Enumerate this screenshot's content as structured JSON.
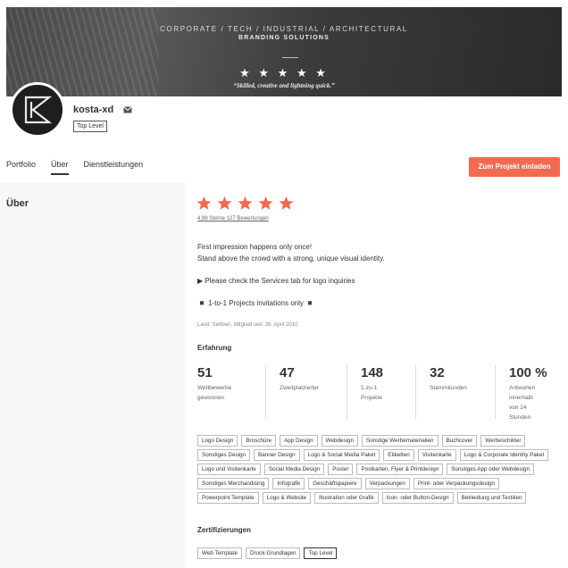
{
  "banner": {
    "line1": "CORPORATE / TECH / INDUSTRIAL / ARCHITECTURAL",
    "line2": "BRANDING SOLUTIONS",
    "stars": "★ ★ ★ ★ ★",
    "quote": "“Skilled, creative and lightning quick.”"
  },
  "profile": {
    "username": "kosta-xd",
    "level": "Top Level"
  },
  "tabs": [
    {
      "label": "Portfolio"
    },
    {
      "label": "Über"
    },
    {
      "label": "Dienstleistungen"
    }
  ],
  "invite_label": "Zum Projekt einladen",
  "section_title": "Über",
  "rating": {
    "stars": 5,
    "text": "4,98 Sterne 127 Bewertungen"
  },
  "bio": {
    "line1": "First impression happens only once!",
    "line2": "Stand above the crowd with a strong, unique visual identity.",
    "line3": "▶ Please check the Services tab for logo inquiries",
    "line4": "◾ 1-to-1 Projects invitations only ◾"
  },
  "meta": "Land: Serbien, Mitglied seit: 26. April 2010",
  "experience_title": "Erfahrung",
  "stats": [
    {
      "value": "51",
      "label": [
        "Wettbewerbe",
        "gewonnen"
      ]
    },
    {
      "value": "47",
      "label": [
        "Zweitplatzierter"
      ]
    },
    {
      "value": "148",
      "label": [
        "1-zu-1",
        "Projekte"
      ]
    },
    {
      "value": "32",
      "label": [
        "Stammkunden"
      ]
    },
    {
      "value": "100 %",
      "label": [
        "Antworten",
        "innerhalb",
        "von 24",
        "Stunden"
      ]
    }
  ],
  "tags": [
    "Logo Design",
    "Broschüre",
    "App Design",
    "Webdesign",
    "Sonstige Werbematerialien",
    "Buchcover",
    "Werbeschilder",
    "Sonstiges Design",
    "Banner Design",
    "Logo & Social Media Paket",
    "Etiketten",
    "Visitenkarte",
    "Logo & Corporate Identity Paket",
    "Logo und Visitenkarte",
    "Social Media Design",
    "Poster",
    "Postkarten, Flyer & Printdesign",
    "Sonstiges App oder Webdesign",
    "Sonstiges Merchandising",
    "Infografik",
    "Geschäftspapiere",
    "Verpackungen",
    "Print- oder Verpackungsdesign",
    "Powerpoint Template",
    "Logo & Website",
    "Illustration oder Grafik",
    "Icon- oder Button-Design",
    "Bekleidung und Textilien"
  ],
  "certifications_title": "Zertifizierungen",
  "certifications": [
    "Web Template",
    "Druck-Grundlagen",
    "Top Level"
  ],
  "colors": {
    "accent": "#f26b50",
    "star": "#f26b50"
  }
}
